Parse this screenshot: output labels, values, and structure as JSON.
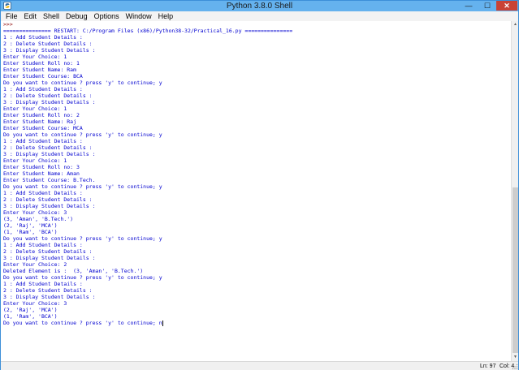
{
  "window": {
    "title": "Python 3.8.0 Shell",
    "minimize": "—",
    "maximize": "☐",
    "close": "✕"
  },
  "menu": [
    "File",
    "Edit",
    "Shell",
    "Debug",
    "Options",
    "Window",
    "Help"
  ],
  "console": [
    {
      "text": ">>> ",
      "kind": "prompt"
    },
    {
      "text": "=============== RESTART: C:/Program Files (x86)/Python38-32/Practical_16.py ===============",
      "kind": "restart"
    },
    {
      "text": "1 : Add Student Details :",
      "kind": "out"
    },
    {
      "text": "2 : Delete Student Details :",
      "kind": "out"
    },
    {
      "text": "3 : Display Student Details :",
      "kind": "out"
    },
    {
      "text": "Enter Your Choice: 1",
      "kind": "out"
    },
    {
      "text": "Enter Student Roll no: 1",
      "kind": "out"
    },
    {
      "text": "Enter Student Name: Ram",
      "kind": "out"
    },
    {
      "text": "Enter Student Course: BCA",
      "kind": "out"
    },
    {
      "text": "Do you want to continue ? press 'y' to continue; y",
      "kind": "out"
    },
    {
      "text": "1 : Add Student Details :",
      "kind": "out"
    },
    {
      "text": "2 : Delete Student Details :",
      "kind": "out"
    },
    {
      "text": "3 : Display Student Details :",
      "kind": "out"
    },
    {
      "text": "Enter Your Choice: 1",
      "kind": "out"
    },
    {
      "text": "Enter Student Roll no: 2",
      "kind": "out"
    },
    {
      "text": "Enter Student Name: Raj",
      "kind": "out"
    },
    {
      "text": "Enter Student Course: MCA",
      "kind": "out"
    },
    {
      "text": "Do you want to continue ? press 'y' to continue; y",
      "kind": "out"
    },
    {
      "text": "1 : Add Student Details :",
      "kind": "out"
    },
    {
      "text": "2 : Delete Student Details :",
      "kind": "out"
    },
    {
      "text": "3 : Display Student Details :",
      "kind": "out"
    },
    {
      "text": "Enter Your Choice: 1",
      "kind": "out"
    },
    {
      "text": "Enter Student Roll no: 3",
      "kind": "out"
    },
    {
      "text": "Enter Student Name: Aman",
      "kind": "out"
    },
    {
      "text": "Enter Student Course: B.Tech.",
      "kind": "out"
    },
    {
      "text": "Do you want to continue ? press 'y' to continue; y",
      "kind": "out"
    },
    {
      "text": "1 : Add Student Details :",
      "kind": "out"
    },
    {
      "text": "2 : Delete Student Details :",
      "kind": "out"
    },
    {
      "text": "3 : Display Student Details :",
      "kind": "out"
    },
    {
      "text": "Enter Your Choice: 3",
      "kind": "out"
    },
    {
      "text": "(3, 'Aman', 'B.Tech.')",
      "kind": "out"
    },
    {
      "text": "(2, 'Raj', 'MCA')",
      "kind": "out"
    },
    {
      "text": "(1, 'Ram', 'BCA')",
      "kind": "out"
    },
    {
      "text": "Do you want to continue ? press 'y' to continue; y",
      "kind": "out"
    },
    {
      "text": "1 : Add Student Details :",
      "kind": "out"
    },
    {
      "text": "2 : Delete Student Details :",
      "kind": "out"
    },
    {
      "text": "3 : Display Student Details :",
      "kind": "out"
    },
    {
      "text": "Enter Your Choice: 2",
      "kind": "out"
    },
    {
      "text": "Deleted Element is :  (3, 'Aman', 'B.Tech.')",
      "kind": "out"
    },
    {
      "text": "Do you want to continue ? press 'y' to continue; y",
      "kind": "out"
    },
    {
      "text": "1 : Add Student Details :",
      "kind": "out"
    },
    {
      "text": "2 : Delete Student Details :",
      "kind": "out"
    },
    {
      "text": "3 : Display Student Details :",
      "kind": "out"
    },
    {
      "text": "Enter Your Choice: 3",
      "kind": "out"
    },
    {
      "text": "(2, 'Raj', 'MCA')",
      "kind": "out"
    },
    {
      "text": "(1, 'Ram', 'BCA')",
      "kind": "out"
    },
    {
      "text": "Do you want to continue ? press 'y' to continue; n",
      "kind": "out"
    }
  ],
  "status": {
    "line": "Ln: 97",
    "col": "Col: 4"
  },
  "colors": {
    "titlebar": "#65b2ee",
    "output_text": "#0000d0",
    "prompt_text": "#8b0000",
    "close_button": "#c94235"
  },
  "icons": {
    "app": "python-idle-icon",
    "scroll_up": "scroll-up-arrow-icon",
    "scroll_down": "scroll-down-arrow-icon",
    "grip": "resize-grip-icon"
  }
}
